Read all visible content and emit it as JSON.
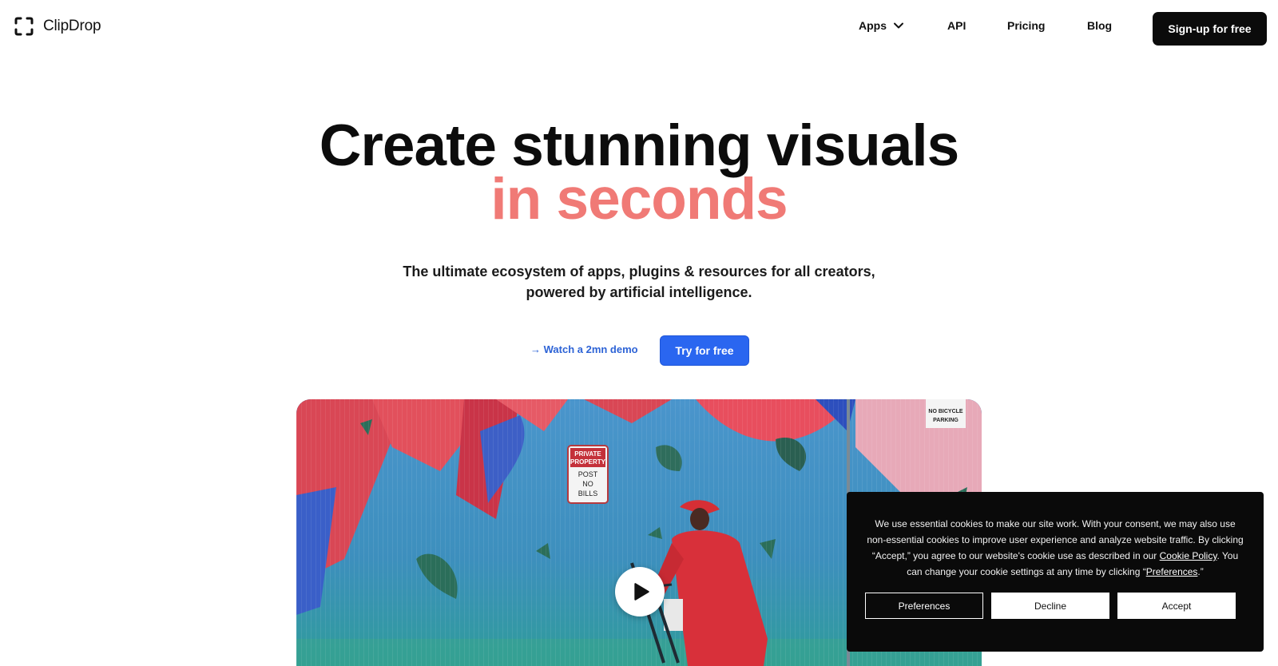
{
  "header": {
    "brand": "ClipDrop",
    "nav": {
      "apps": "Apps",
      "api": "API",
      "pricing": "Pricing",
      "blog": "Blog"
    },
    "signup_label": "Sign-up for free"
  },
  "hero": {
    "title_line1": "Create stunning visuals",
    "title_line2": "in seconds",
    "subtitle_line1": "The ultimate ecosystem of apps, plugins & resources for all creators,",
    "subtitle_line2": "powered by artificial intelligence.",
    "demo_link": "→ Watch a 2mn demo",
    "try_label": "Try for free"
  },
  "video": {
    "sign_private": [
      "PRIVATE",
      "PROPERTY"
    ],
    "sign_post": [
      "POST",
      "NO",
      "BILLS"
    ],
    "sign_bicycle": [
      "NO BICYCLE",
      "PARKING"
    ]
  },
  "cookie": {
    "text_before_policy": "We use essential cookies to make our site work. With your consent, we may also use non-essential cookies to improve user experience and analyze website traffic. By clicking “Accept,” you agree to our website's cookie use as described in our ",
    "policy_link": "Cookie Policy",
    "text_after_policy": ". You can change your cookie settings at any time by clicking “",
    "preferences_link": "Preferences",
    "text_end": ".”",
    "preferences_label": "Preferences",
    "decline_label": "Decline",
    "accept_label": "Accept"
  },
  "colors": {
    "accent_blue": "#2a66f0",
    "headline_coral": "#f07a76",
    "dark": "#0b0b0b"
  }
}
